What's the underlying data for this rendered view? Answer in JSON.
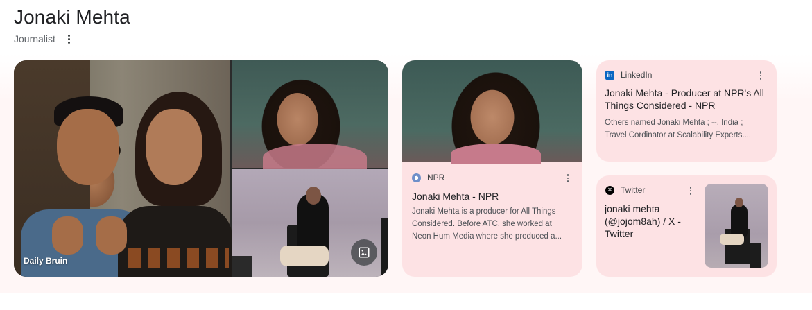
{
  "header": {
    "title": "Jonaki Mehta",
    "subtitle": "Journalist"
  },
  "images": {
    "main_source": "Daily Bruin"
  },
  "cards": {
    "npr": {
      "source": "NPR",
      "title": "Jonaki Mehta - NPR",
      "snippet_line1": "Jonaki Mehta is a producer for All Things",
      "snippet_line2": "Considered. Before ATC, she worked at",
      "snippet_line3": "Neon Hum Media where she produced a..."
    },
    "linkedin": {
      "source": "LinkedIn",
      "title_line1": "Jonaki Mehta - Producer at NPR's All",
      "title_line2": "Things Considered - NPR",
      "snippet_line1": "Others named Jonaki Mehta ; --. India ;",
      "snippet_line2": "Travel Cordinator at Scalability Experts...."
    },
    "twitter": {
      "source": "Twitter",
      "title_line1": "jonaki mehta",
      "title_line2": "(@jojom8ah) / X -",
      "title_line3": "Twitter"
    }
  },
  "colors": {
    "card_bg": "#fde2e4",
    "linkedin_blue": "#0a66c2",
    "npr_globe": "#6e8fc9"
  },
  "icons": [
    "more-vert-icon",
    "image-icon",
    "globe-icon",
    "linkedin-icon",
    "x-icon"
  ]
}
